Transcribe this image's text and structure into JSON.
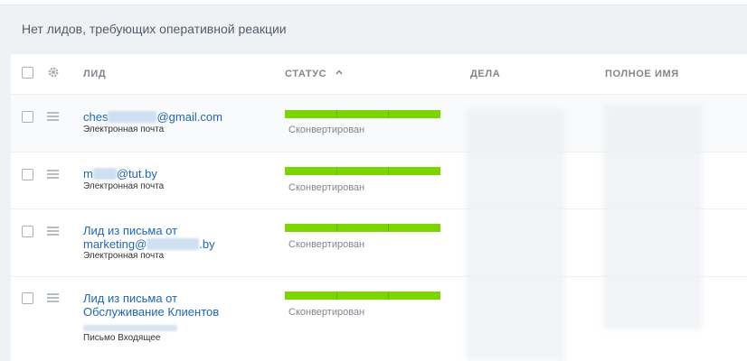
{
  "banner": {
    "text": "Нет лидов, требующих оперативной реакции"
  },
  "columns": {
    "lead": "ЛИД",
    "status": "СТАТУС",
    "deals": "ДЕЛА",
    "full_name": "ПОЛНОЕ ИМЯ"
  },
  "rows": [
    {
      "title_prefix": "ches",
      "title_suffix": "@gmail.com",
      "title_line2": "",
      "subtitle": "Электронная почта",
      "status": "Сконвертирован",
      "progress": 1.0
    },
    {
      "title_prefix": "m",
      "title_suffix": "@tut.by",
      "title_line2": "",
      "subtitle": "Электронная почта",
      "status": "Сконвертирован",
      "progress": 1.0
    },
    {
      "title_prefix": "Лид из письма от",
      "title_line2_prefix": "marketing@",
      "title_line2_suffix": ".by",
      "subtitle": "Электронная почта",
      "status": "Сконвертирован",
      "progress": 1.0
    },
    {
      "title_prefix": "Лид из письма от",
      "title_line2": "Обслуживание Клиентов",
      "subtitle": "Письмо Входящее",
      "status": "Сконвертирован",
      "progress": 1.0
    }
  ],
  "colors": {
    "progress": "#7bd500",
    "link": "#2067b0",
    "background": "#eef2f4"
  },
  "icons": [
    "gear-icon",
    "sort-up-icon",
    "drag-handle-icon"
  ]
}
